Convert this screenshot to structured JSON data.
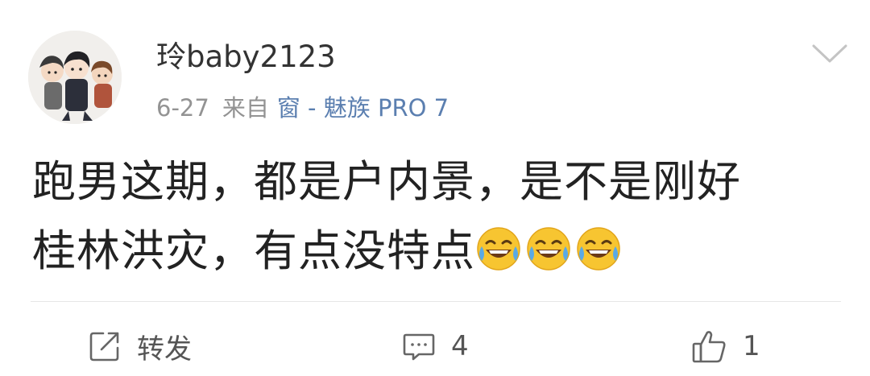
{
  "post": {
    "username": "玲baby2123",
    "date": "6-27",
    "from_label": "来自",
    "source": "窗 - 魅族 PRO 7",
    "text_line1": "跑男这期，都是户内景，是不是刚好",
    "text_line2": "桂林洪灾，有点没特点",
    "emojis": [
      "laugh-cry-emoji",
      "laugh-cry-emoji",
      "laugh-cry-emoji"
    ]
  },
  "actions": {
    "repost_label": "转发",
    "comment_count": "4",
    "like_count": "1"
  },
  "colors": {
    "username": "#333333",
    "meta": "#939393",
    "source_link": "#5b7fb0",
    "body_text": "#222222",
    "divider": "#e6e6e6",
    "icon": "#666666"
  },
  "icons": {
    "menu": "chevron-down-icon",
    "repost": "share-icon",
    "comment": "comment-icon",
    "like": "thumbs-up-icon"
  }
}
